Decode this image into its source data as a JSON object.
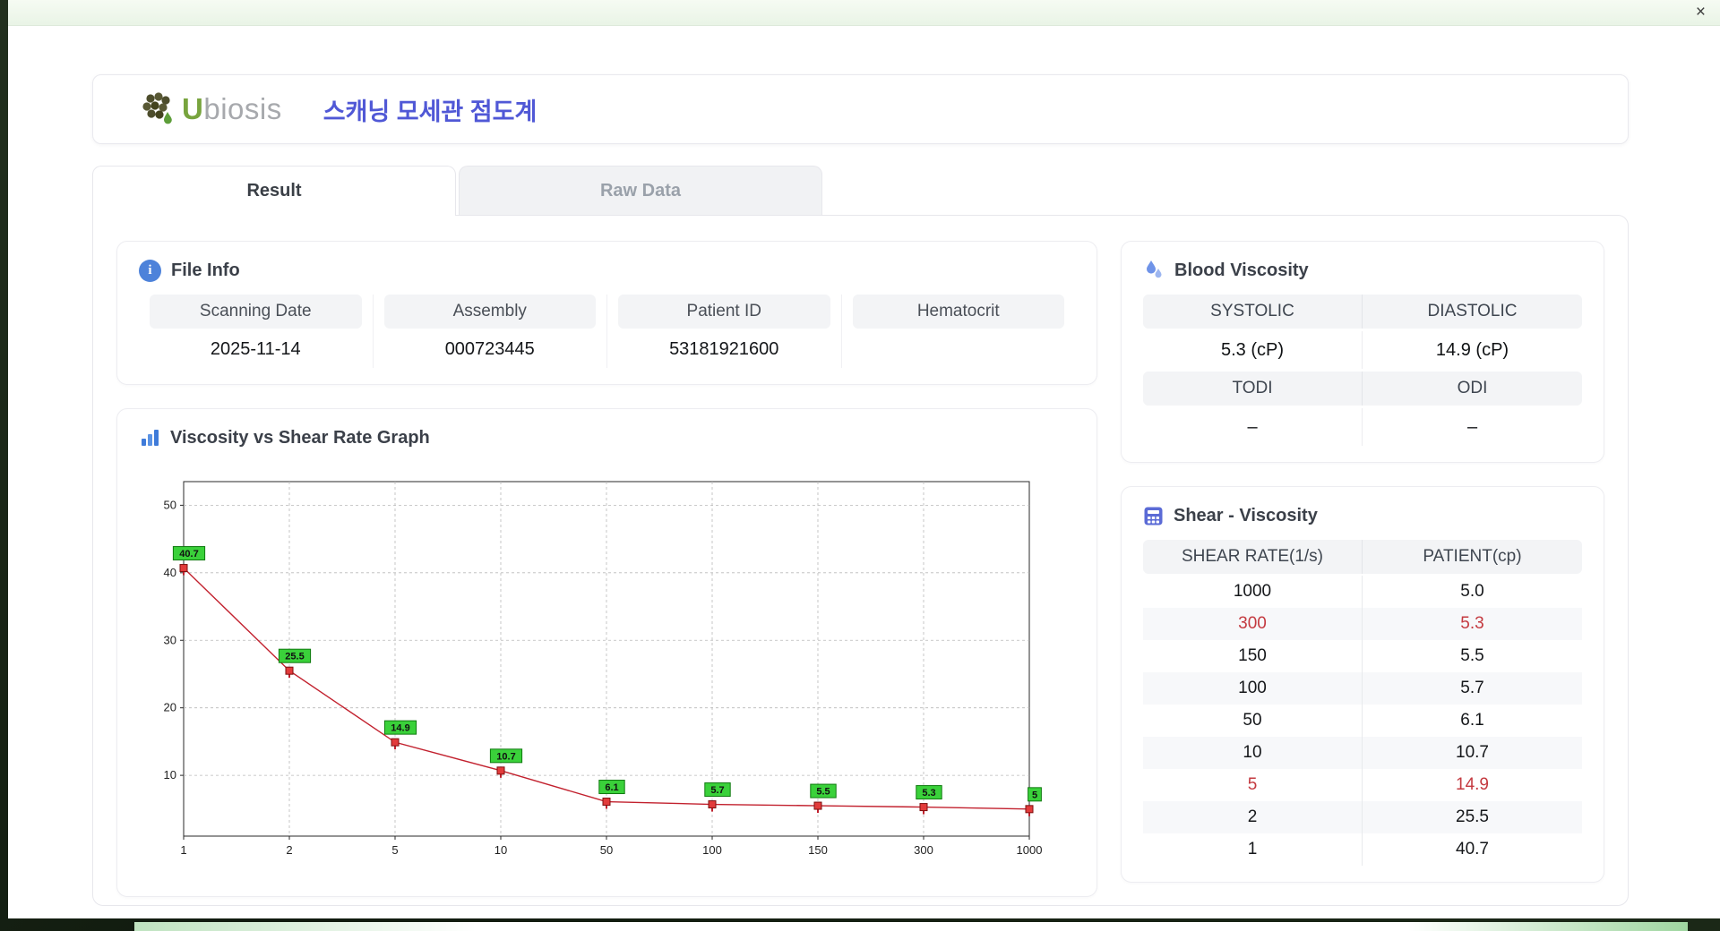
{
  "window": {
    "close_icon": "×"
  },
  "header": {
    "brand_u": "U",
    "brand_rest": "biosis",
    "app_title": "스캐닝 모세관 점도계"
  },
  "tabs": [
    {
      "label": "Result",
      "active": true
    },
    {
      "label": "Raw Data",
      "active": false
    }
  ],
  "file_info": {
    "title": "File Info",
    "fields": [
      {
        "label": "Scanning Date",
        "value": "2025-11-14"
      },
      {
        "label": "Assembly",
        "value": "000723445"
      },
      {
        "label": "Patient ID",
        "value": "53181921600"
      },
      {
        "label": "Hematocrit",
        "value": ""
      }
    ]
  },
  "blood_viscosity": {
    "title": "Blood Viscosity",
    "row1": {
      "headers": [
        "SYSTOLIC",
        "DIASTOLIC"
      ],
      "values": [
        "5.3 (cP)",
        "14.9 (cP)"
      ]
    },
    "row2": {
      "headers": [
        "TODI",
        "ODI"
      ],
      "values": [
        "–",
        "–"
      ]
    }
  },
  "shear_viscosity": {
    "title": "Shear - Viscosity",
    "columns": [
      "SHEAR RATE(1/s)",
      "PATIENT(cp)"
    ],
    "rows": [
      {
        "shear": "1000",
        "patient": "5.0",
        "highlight": false
      },
      {
        "shear": "300",
        "patient": "5.3",
        "highlight": true
      },
      {
        "shear": "150",
        "patient": "5.5",
        "highlight": false
      },
      {
        "shear": "100",
        "patient": "5.7",
        "highlight": false
      },
      {
        "shear": "50",
        "patient": "6.1",
        "highlight": false
      },
      {
        "shear": "10",
        "patient": "10.7",
        "highlight": false
      },
      {
        "shear": "5",
        "patient": "14.9",
        "highlight": true
      },
      {
        "shear": "2",
        "patient": "25.5",
        "highlight": false
      },
      {
        "shear": "1",
        "patient": "40.7",
        "highlight": false
      }
    ]
  },
  "chart_data": {
    "type": "line",
    "title": "Viscosity vs Shear Rate Graph",
    "xlabel": "",
    "ylabel": "",
    "x_categories": [
      "1",
      "2",
      "5",
      "10",
      "50",
      "100",
      "150",
      "300",
      "1000"
    ],
    "values": [
      40.7,
      25.5,
      14.9,
      10.7,
      6.1,
      5.7,
      5.5,
      5.3,
      5.0
    ],
    "point_labels": [
      "40.7",
      "25.5",
      "14.9",
      "10.7",
      "6.1",
      "5.7",
      "5.5",
      "5.3",
      "5"
    ],
    "y_ticks": [
      10,
      20,
      30,
      40,
      50
    ],
    "ylim": [
      1,
      53.5
    ],
    "x_scale": "log-category",
    "grid": "dashed",
    "legend": "none",
    "line_color": "#c2212e",
    "marker_color": "#e23b3b",
    "marker_edge": "#7d0f0f",
    "label_bg": "#3ad13a",
    "label_edge": "#0f7a0f"
  },
  "colors": {
    "accent_blue": "#4d82da",
    "title_indigo": "#5058d6",
    "highlight_red": "#c43a40",
    "brand_green": "#78a43e",
    "brand_gray": "#a7a9ad"
  }
}
